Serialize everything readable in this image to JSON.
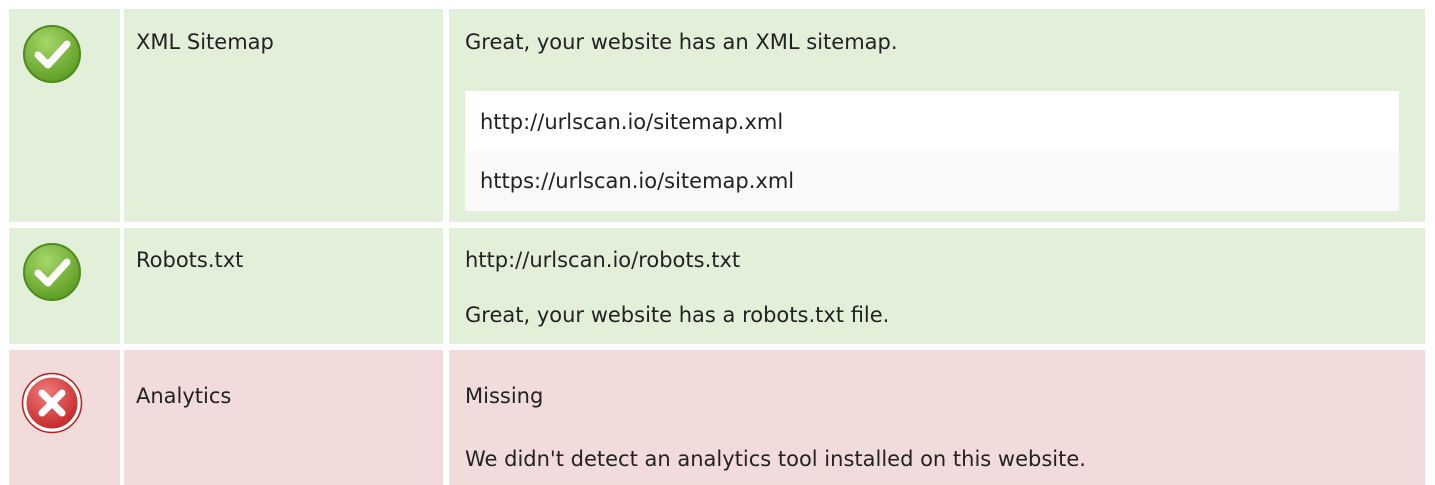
{
  "colors": {
    "pass_row_bg": "#e2efd9",
    "fail_row_bg": "#f2dcdb",
    "pass_icon": "#7cb83a",
    "fail_icon": "#d93a3a"
  },
  "rows": [
    {
      "status": "pass",
      "status_icon": "check-circle-icon",
      "label": "XML Sitemap",
      "message": "Great, your website has an XML sitemap.",
      "urls": [
        "http://urlscan.io/sitemap.xml",
        "https://urlscan.io/sitemap.xml"
      ]
    },
    {
      "status": "pass",
      "status_icon": "check-circle-icon",
      "label": "Robots.txt",
      "url": "http://urlscan.io/robots.txt",
      "message": "Great, your website has a robots.txt file."
    },
    {
      "status": "fail",
      "status_icon": "cross-circle-icon",
      "label": "Analytics",
      "value": "Missing",
      "message": "We didn't detect an analytics tool installed on this website."
    }
  ]
}
